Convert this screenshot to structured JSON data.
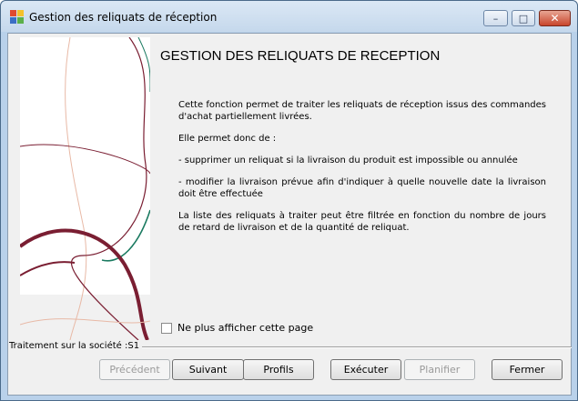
{
  "window": {
    "title": "Gestion des reliquats de réception",
    "controls": {
      "minimize": "–",
      "maximize": "□",
      "close": "✕"
    }
  },
  "wizard": {
    "heading": "GESTION DES RELIQUATS DE RECEPTION",
    "paragraphs": [
      "Cette fonction permet de traiter les reliquats de réception issus des commandes d'achat partiellement livrées.",
      "Elle permet donc de :",
      "- supprimer un reliquat si la livraison du produit est impossible ou annulée",
      "- modifier la livraison prévue afin d'indiquer à quelle nouvelle date la livraison doit être effectuée",
      "La liste des reliquats à traiter peut être filtrée en fonction du nombre de jours de retard de livraison et de la quantité de reliquat."
    ],
    "hide_page_checkbox": {
      "label": "Ne plus afficher cette page",
      "checked": false
    }
  },
  "status": {
    "societe_label": "Traitement sur la société :S1"
  },
  "buttons": {
    "previous": "Précédent",
    "next": "Suivant",
    "profiles": "Profils",
    "execute": "Exécuter",
    "schedule": "Planifier",
    "close": "Fermer"
  },
  "colors": {
    "title_bar": "#c5d8ec",
    "close_button": "#c8452c",
    "decor_wine": "#7a1e32",
    "decor_teal": "#1a7a60",
    "decor_peach": "#e8b9a6"
  },
  "icons": {
    "app": "colored-squares-icon",
    "minimize": "minimize-icon",
    "maximize": "maximize-icon",
    "close": "close-icon"
  }
}
